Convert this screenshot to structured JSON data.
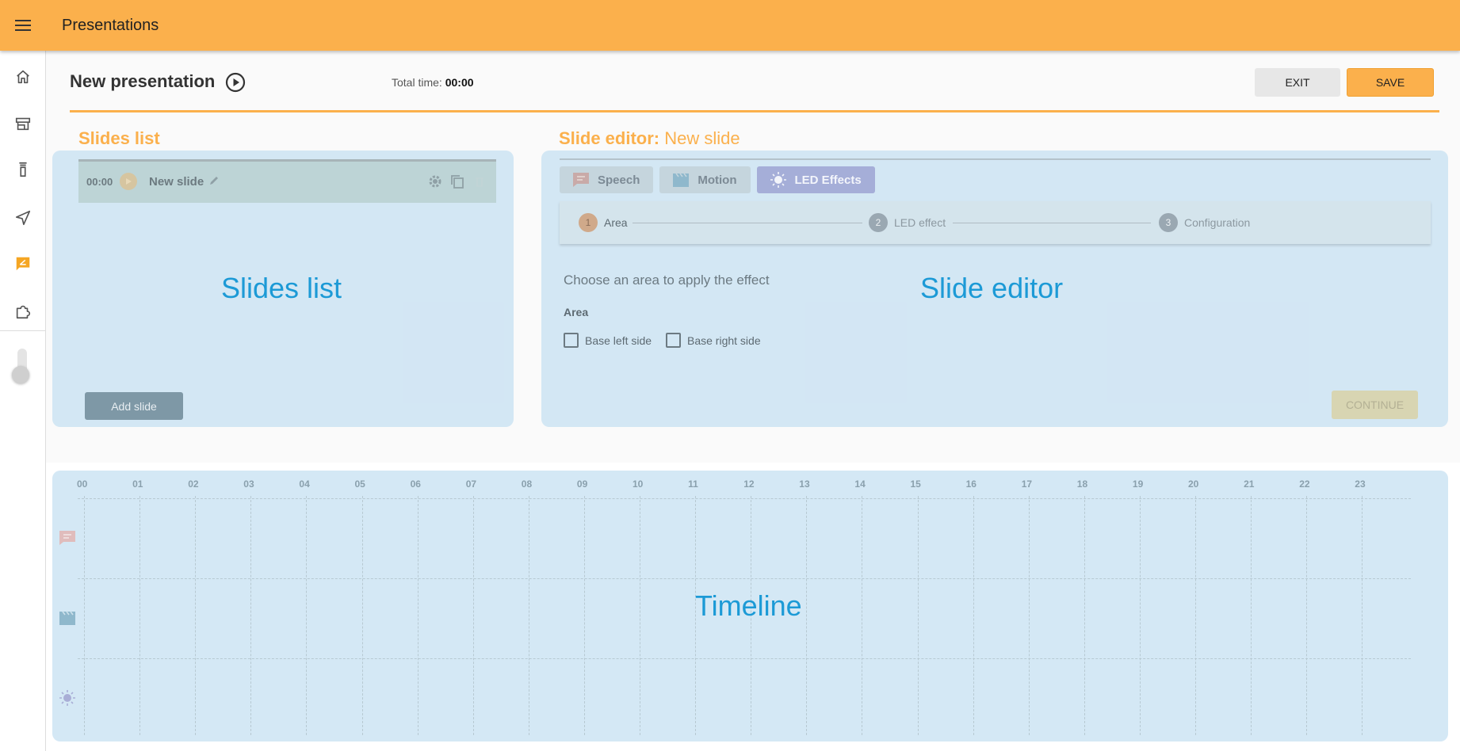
{
  "app": {
    "title": "Presentations"
  },
  "sidebar": {
    "items": [
      {
        "name": "home-icon",
        "active": false
      },
      {
        "name": "store-icon",
        "active": false
      },
      {
        "name": "robot-icon",
        "active": false
      },
      {
        "name": "navigation-icon",
        "active": false
      },
      {
        "name": "presentation-icon",
        "active": true
      },
      {
        "name": "puzzle-icon",
        "active": false
      }
    ]
  },
  "presentation": {
    "title": "New presentation",
    "total_time_label": "Total time:",
    "total_time": "00:00",
    "exit_label": "EXIT",
    "save_label": "SAVE"
  },
  "slides_list": {
    "title": "Slides list",
    "overlay_label": "Slides list",
    "add_label": "Add slide",
    "slides": [
      {
        "time": "00:00",
        "name": "New slide"
      }
    ]
  },
  "editor": {
    "title": "Slide editor:",
    "subtitle": "New slide",
    "overlay_label": "Slide editor",
    "tabs": [
      {
        "label": "Speech",
        "icon": "speech-icon",
        "active": false
      },
      {
        "label": "Motion",
        "icon": "motion-icon",
        "active": false
      },
      {
        "label": "LED Effects",
        "icon": "led-icon",
        "active": true
      }
    ],
    "steps": [
      {
        "num": "1",
        "label": "Area",
        "active": true
      },
      {
        "num": "2",
        "label": "LED effect",
        "active": false
      },
      {
        "num": "3",
        "label": "Configuration",
        "active": false
      }
    ],
    "instruction": "Choose an area to apply the effect",
    "area_label": "Area",
    "options": [
      "Base left side",
      "Base right side"
    ],
    "continue_label": "CONTINUE"
  },
  "timeline": {
    "overlay_label": "Timeline",
    "ticks": [
      "00",
      "01",
      "02",
      "03",
      "04",
      "05",
      "06",
      "07",
      "08",
      "09",
      "10",
      "11",
      "12",
      "13",
      "14",
      "15",
      "16",
      "17",
      "18",
      "19",
      "20",
      "21",
      "22",
      "23"
    ],
    "tracks": [
      "speech-icon",
      "motion-icon",
      "led-icon"
    ]
  },
  "colors": {
    "accent": "#fbb04c",
    "overlay": "#c8e1f2",
    "overlay_text": "#1c9ad6"
  }
}
